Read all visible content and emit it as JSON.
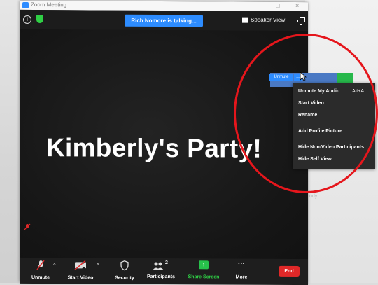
{
  "window": {
    "title": "Zoom Meeting",
    "controls": [
      "–",
      "□",
      "×"
    ]
  },
  "topbar": {
    "talking_banner": "Rich Nomore is talking...",
    "speaker_view": "Speaker View"
  },
  "main": {
    "meeting_name": "Kimberly's Party!"
  },
  "thumbnail": {
    "unmute_label": "Unmute",
    "more_label": "..."
  },
  "menu": {
    "items": [
      {
        "label": "Unmute My Audio",
        "shortcut": "Alt+A"
      },
      {
        "label": "Start Video"
      },
      {
        "label": "Rename"
      },
      {
        "label": "Add Profile Picture"
      },
      {
        "label": "Hide Non-Video Participants"
      },
      {
        "label": "Hide Self View"
      }
    ]
  },
  "toolbar": {
    "unmute": "Unmute",
    "start_video": "Start Video",
    "security": "Security",
    "participants": "Participants",
    "participants_count": "2",
    "share_screen": "Share Screen",
    "more": "More",
    "end": "End"
  },
  "background": {
    "paper_text": "ody"
  },
  "colors": {
    "zoom_blue": "#2d8cff",
    "end_red": "#e02828",
    "share_green": "#27c14b",
    "annotation_red": "#e5161c"
  }
}
